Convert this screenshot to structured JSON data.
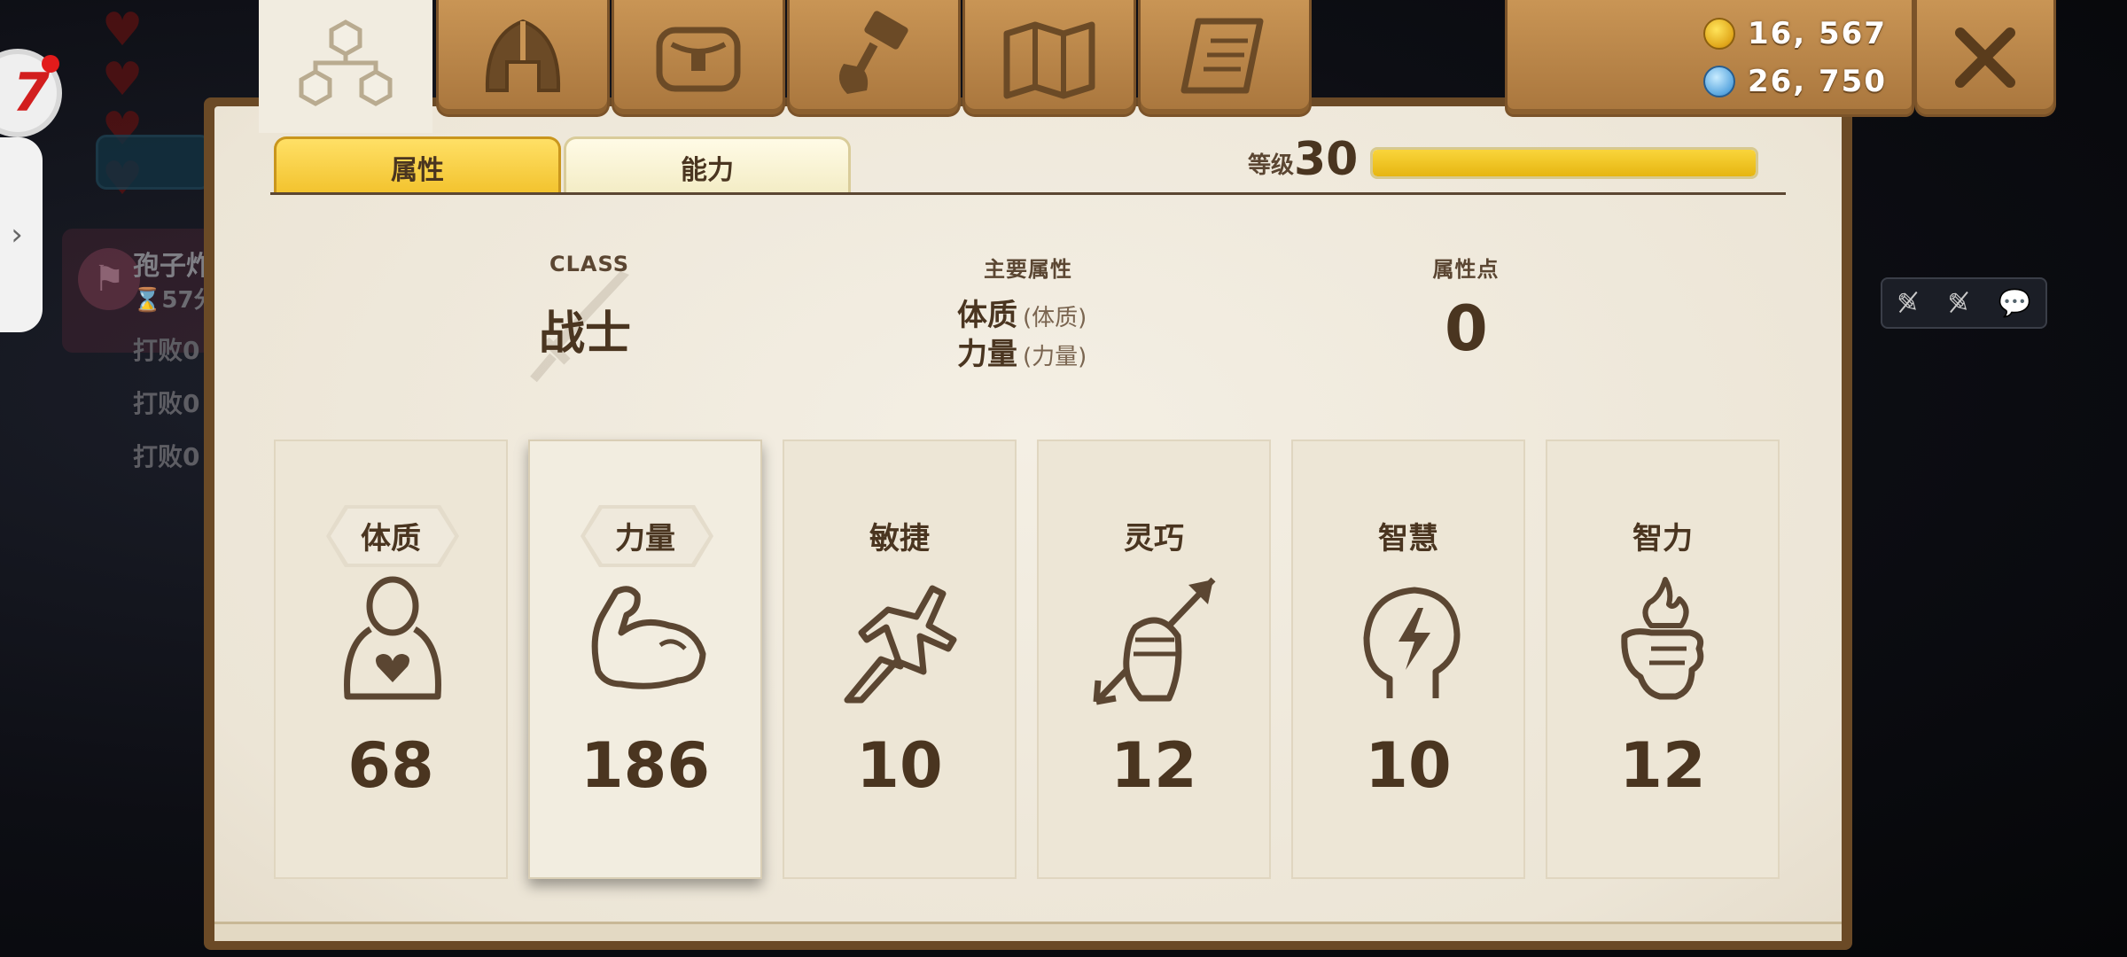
{
  "background": {
    "hearts": [
      "♥",
      "♥",
      "♥",
      "♥"
    ],
    "side_tab_arrow": "›",
    "quest": {
      "title": "孢子炸",
      "timer": "⌛57分",
      "lines": [
        "打败0",
        "打败0",
        "打败0"
      ]
    },
    "chat_toolbar": [
      "✎̸",
      "✎̸",
      "💬"
    ]
  },
  "top_tabs": [
    {
      "name": "attributes",
      "icon": "hierarchy-icon",
      "active": true
    },
    {
      "name": "equipment",
      "icon": "helmet-icon",
      "active": false
    },
    {
      "name": "inventory",
      "icon": "bag-icon",
      "active": false
    },
    {
      "name": "crafting",
      "icon": "hammer-icon",
      "active": false
    },
    {
      "name": "map",
      "icon": "map-icon",
      "active": false
    },
    {
      "name": "quests",
      "icon": "scroll-icon",
      "active": false
    }
  ],
  "currency": {
    "gold": "16, 567",
    "gems": "26, 750"
  },
  "sub_tabs": {
    "attributes": "属性",
    "abilities": "能力"
  },
  "level": {
    "label": "等级",
    "value": "30",
    "progress": 1.0
  },
  "info": {
    "class_label": "CLASS",
    "class_name": "战士",
    "primary_label": "主要属性",
    "primary": [
      {
        "name": "体质",
        "sub": "(体质)"
      },
      {
        "name": "力量",
        "sub": "(力量)"
      }
    ],
    "points_label": "属性点",
    "points_value": "0"
  },
  "stats": [
    {
      "name": "体质",
      "value": "68",
      "icon": "body-heart-icon",
      "badge": true,
      "selected": false
    },
    {
      "name": "力量",
      "value": "186",
      "icon": "flex-arm-icon",
      "badge": true,
      "selected": true
    },
    {
      "name": "敏捷",
      "value": "10",
      "icon": "running-icon",
      "badge": false,
      "selected": false
    },
    {
      "name": "灵巧",
      "value": "12",
      "icon": "hand-arrow-icon",
      "badge": false,
      "selected": false
    },
    {
      "name": "智慧",
      "value": "10",
      "icon": "head-lightning-icon",
      "badge": false,
      "selected": false
    },
    {
      "name": "智力",
      "value": "12",
      "icon": "hand-flame-icon",
      "badge": false,
      "selected": false
    }
  ],
  "colors": {
    "panel_brown": "#a9763d",
    "parchment": "#f1ece0",
    "text_dark": "#4a3520",
    "xp_fill": "#f2c22c"
  }
}
